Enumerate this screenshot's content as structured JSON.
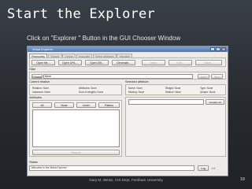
{
  "slide": {
    "title": "Start the Explorer",
    "subtitle": "Click on \"Explorer \" Button in the GUI Chooser Window",
    "footer": "Gary M. Weiss, CIS Dept, Fordham University",
    "page_number": "18"
  },
  "window": {
    "title": "Weka Explorer",
    "controls": [
      "–",
      "□",
      "×"
    ],
    "tabs": [
      {
        "label": "Preprocess",
        "active": true
      },
      {
        "label": "Classify",
        "active": false
      },
      {
        "label": "Cluster",
        "active": false
      },
      {
        "label": "Associate",
        "active": false
      },
      {
        "label": "Select attributes",
        "active": false
      },
      {
        "label": "Visualize",
        "active": false
      }
    ],
    "toolbar": {
      "open_file": "Open file...",
      "open_url": "Open URL...",
      "open_db": "Open DB...",
      "generate": "Generate...",
      "undo": "Undo",
      "edit": "Edit...",
      "save": "Save..."
    },
    "filter": {
      "section_label": "Filter",
      "choose_label": "Choose",
      "value": "None",
      "apply_label": "Apply",
      "stop_label": "Stop"
    },
    "current_relation": {
      "section_label": "Current relation",
      "relation": "Relation: None",
      "instances": "Instances: None",
      "attributes": "Attributes: None",
      "sum_of_weights": "Sum of weights: None"
    },
    "attributes_panel": {
      "section_label": "Attributes",
      "buttons": [
        "All",
        "None",
        "Invert",
        "Pattern"
      ],
      "remove_label": "Remove"
    },
    "selected_attribute": {
      "section_label": "Selected attribute",
      "name": "Name: None",
      "missing": "Missing: None",
      "weight": "Weight: None",
      "distinct": "Distinct: None",
      "type": "Type: None",
      "unique": "Unique: None",
      "visualize_all_label": "Visualize All"
    },
    "status": {
      "section_label": "Status",
      "message": "Welcome to the Weka Explorer",
      "log_label": "Log",
      "count": "x 0"
    }
  }
}
